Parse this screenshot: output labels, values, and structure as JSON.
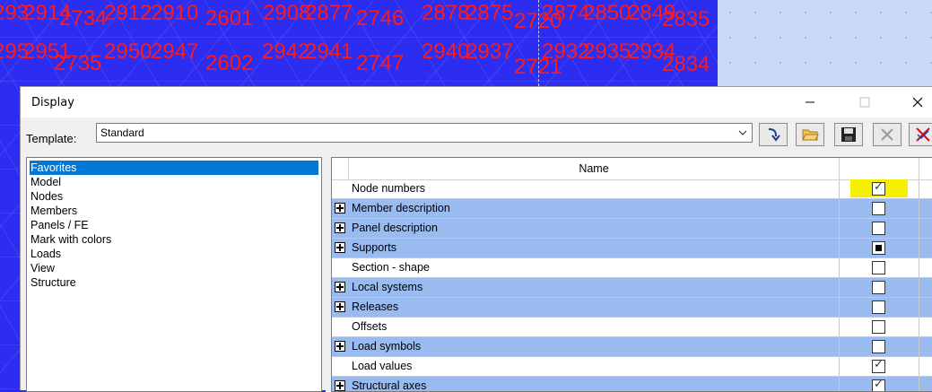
{
  "canvas": {
    "node_numbers": [
      "293",
      "2914",
      "2734",
      "2912",
      "2910",
      "2601",
      "2908",
      "2877",
      "2746",
      "2878",
      "2875",
      "2720",
      "2874",
      "2850",
      "2849",
      "2835",
      "295",
      "2951",
      "2735",
      "2950",
      "2947",
      "2602",
      "2942",
      "2941",
      "2747",
      "2940",
      "2937",
      "2721",
      "2932",
      "2935",
      "2934",
      "2834"
    ]
  },
  "dialog": {
    "title": "Display",
    "template_label": "Template:",
    "template_value": "Standard",
    "toolbar": {
      "load": "load-template-icon",
      "open": "open-folder-icon",
      "save": "save-disk-icon",
      "delete": "delete-x-icon",
      "reset": "reset-icon"
    },
    "categories": [
      "Favorites",
      "Model",
      "Nodes",
      "Members",
      "Panels / FE",
      "Mark with colors",
      "Loads",
      "View",
      "Structure"
    ],
    "grid": {
      "column_header": "Name",
      "rows": [
        {
          "label": "Node numbers",
          "expandable": false,
          "state": "checked",
          "highlighted": true
        },
        {
          "label": "Member description",
          "expandable": true,
          "state": "unchecked"
        },
        {
          "label": "Panel description",
          "expandable": true,
          "state": "unchecked"
        },
        {
          "label": "Supports",
          "expandable": true,
          "state": "partial"
        },
        {
          "label": "Section - shape",
          "expandable": false,
          "state": "unchecked"
        },
        {
          "label": "Local systems",
          "expandable": true,
          "state": "unchecked"
        },
        {
          "label": "Releases",
          "expandable": true,
          "state": "unchecked"
        },
        {
          "label": "Offsets",
          "expandable": false,
          "state": "unchecked"
        },
        {
          "label": "Load symbols",
          "expandable": true,
          "state": "unchecked"
        },
        {
          "label": "Load values",
          "expandable": false,
          "state": "checked"
        },
        {
          "label": "Structural axes",
          "expandable": true,
          "state": "checked"
        }
      ]
    },
    "colors": {
      "selection": "#0078d7",
      "group_row": "#99bbef",
      "highlight": "#f5f000",
      "model_background": "#2d2df2",
      "node_number_text": "#ff1a1a"
    }
  }
}
